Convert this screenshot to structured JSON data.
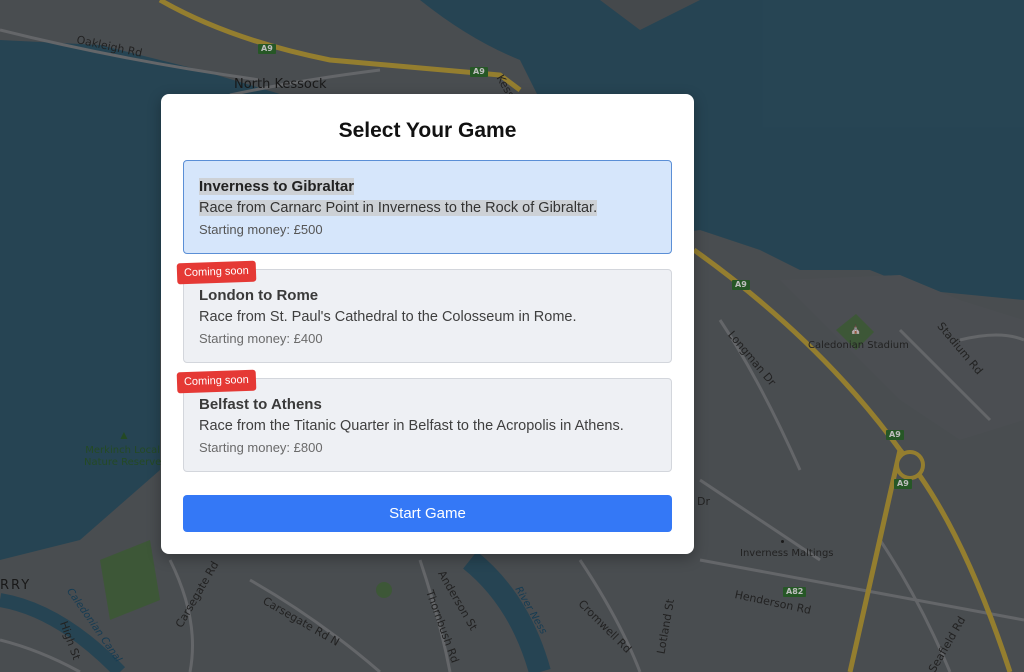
{
  "map": {
    "labels": {
      "north_kessock": "North Kessock",
      "oakleigh_rd": "Oakleigh Rd",
      "kessock_partial": "Kess",
      "longman_dr": "Longman Dr",
      "caledonian_stadium": "Caledonian Stadium",
      "stadium_rd": "Stadium Rd",
      "merkinch_reserve": "Merkinch Local\nNature Reserve",
      "inverness_maltings": "Inverness Maltings",
      "henderson_rd": "Henderson Rd",
      "carsegate_rd": "Carsegate Rd",
      "carsegate_rd_n": "Carsegate Rd N",
      "anderson_st": "Anderson St",
      "thornbush_rd": "Thornbush Rd",
      "river_ness": "River Ness",
      "cromwell_rd": "Cromwell Rd",
      "lotland_st": "Lotland St",
      "seafield_rd": "Seafield Rd",
      "caledonian_canal": "Caledonian Canal",
      "high_st": "High St",
      "rry_partial": "RRY",
      "dr_partial": "Dr"
    },
    "shields": {
      "a9_1": "A9",
      "a9_2": "A9",
      "a9_3": "A9",
      "a9_4": "A9",
      "a9_5": "A9",
      "a82": "A82"
    },
    "colors": {
      "water": "#2f5466",
      "land": "#5a5e62",
      "road": "#7a7d80",
      "trunk_road": "#b59a3a",
      "park": "#4b6b44"
    }
  },
  "modal": {
    "title": "Select Your Game",
    "games": [
      {
        "name": "Inverness to Gibraltar",
        "description": "Race from Carnarc Point in Inverness to the Rock of Gibraltar.",
        "money": "Starting money: £500",
        "selected": true,
        "badge": ""
      },
      {
        "name": "London to Rome",
        "description": "Race from St. Paul's Cathedral to the Colosseum in Rome.",
        "money": "Starting money: £400",
        "selected": false,
        "badge": "Coming soon"
      },
      {
        "name": "Belfast to Athens",
        "description": "Race from the Titanic Quarter in Belfast to the Acropolis in Athens.",
        "money": "Starting money: £800",
        "selected": false,
        "badge": "Coming soon"
      }
    ],
    "start_label": "Start Game",
    "colors": {
      "selected_bg": "#d6e6fb",
      "selected_border": "#5b8fd6",
      "locked_bg": "#eef0f4",
      "badge": "#e53935",
      "button": "#3478f6"
    }
  }
}
